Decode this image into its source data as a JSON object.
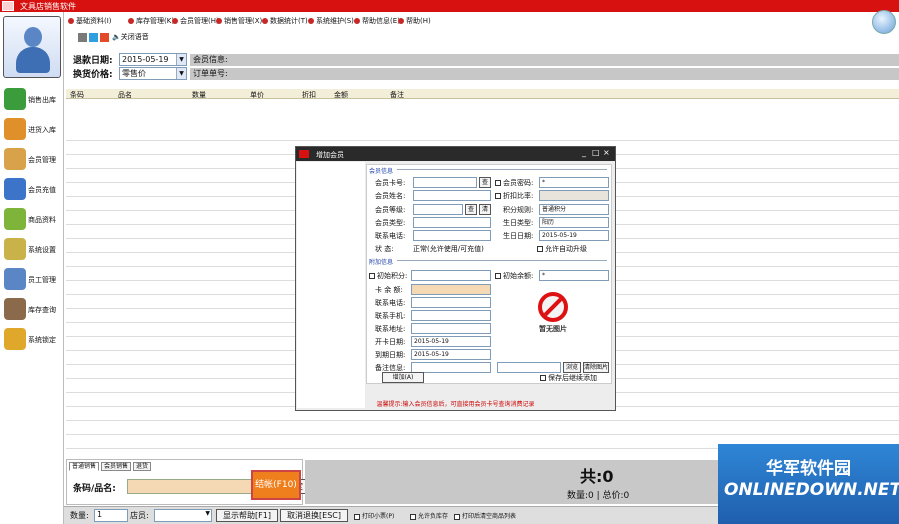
{
  "window": {
    "title": "文具店销售软件"
  },
  "menu": [
    "基础资料(I)",
    "库存管理(K)",
    "会员管理(H)",
    "销售管理(X)",
    "数据统计(T)",
    "系统维护(S)",
    "帮助信息(E)",
    "帮助(H)"
  ],
  "toolbar": {
    "volume_label": "关闭语音 ",
    "colors": [
      "#7a7a7a",
      "#2f9fe0",
      "#e24a2a"
    ]
  },
  "sidebar": {
    "items": [
      {
        "label": "销售出库",
        "icon": "cashier-icon",
        "color": "#3a9c3a"
      },
      {
        "label": "进货入库",
        "icon": "boxes-icon",
        "color": "#e0902a"
      },
      {
        "label": "会员管理",
        "icon": "members-icon",
        "color": "#d8a24a"
      },
      {
        "label": "会员充值",
        "icon": "card-icon",
        "color": "#3c74c9"
      },
      {
        "label": "商品资料",
        "icon": "goods-icon",
        "color": "#7fb43a"
      },
      {
        "label": "系统设置",
        "icon": "tools-icon",
        "color": "#c9b24a"
      },
      {
        "label": "员工管理",
        "icon": "staff-icon",
        "color": "#5a86c6"
      },
      {
        "label": "库存查询",
        "icon": "house-icon",
        "color": "#8a6a4a"
      },
      {
        "label": "系统锁定",
        "icon": "lock-icon",
        "color": "#e0a82a"
      }
    ]
  },
  "filters": {
    "date_label": "退款日期:",
    "date_value": "2015-05-19",
    "price_label": "换货价格:",
    "price_value": "零售价",
    "member_info": "会员信息:",
    "receipt_no": "订单单号:"
  },
  "table": {
    "headers": [
      "条码",
      "品名",
      "数量",
      "单价",
      "折扣",
      "金额",
      "备注"
    ]
  },
  "dialog": {
    "title": "增加会员",
    "section_basic": "会员信息",
    "section_more": "附加信息",
    "fields": {
      "card_no": "会员卡号:",
      "member_name": "会员姓名:",
      "member_level": "会员等级:",
      "member_type": "会员类型:",
      "phone": "联系电话:",
      "status": "状    态:",
      "status_value": "正常(允许使用/可充值)",
      "password": "会员密码:",
      "discount_rate": "折扣比率:",
      "points_rule": "积分规则:",
      "points_rule_value": "普通积分",
      "birthday_type": "生日类型:",
      "birthday_type_value": "阳历",
      "birthday": "生日日期:",
      "birthday_value": "2015-05-19",
      "auto_upgrade": "允许自动升级",
      "init_points": "初始积分:",
      "init_balance": "初始余额:",
      "balance": "卡 余 额:",
      "contact1": "联系电话:",
      "contact2": "联系手机:",
      "address": "联系地址:",
      "open_date": "开卡日期:",
      "open_date_value": "2015-05-19",
      "expire_date": "到期日期:",
      "expire_date_value": "2015-05-19",
      "note": "备注信息:",
      "password_value": "*",
      "confirm_value": "*"
    },
    "photo_text": "暂无图片",
    "browse_btn": "浏览",
    "clear_btn": "清除图片",
    "add_btn": "增加(A)",
    "keep_open": "保存后继续添加",
    "hint": "温馨提示:输入会员信息后，可直接用会员卡号查询消费记录",
    "search_btn": "查",
    "clear_small": "清"
  },
  "bottom": {
    "tabs": [
      "普通销售",
      "会员销售",
      "退货"
    ],
    "code_label": "条码/品名:",
    "confirm_btn": "确定",
    "checkout_btn": "结帐(F10)",
    "total_label": "共:0",
    "stats_label": "数量:0 | 总价:0"
  },
  "status": {
    "qty_label": "数量:",
    "qty_value": "1",
    "store_label": "店员:",
    "show_help": "显示帮助[F1]",
    "cancel_btn": "取消退换[ESC]",
    "checks": [
      "打印小票(P)",
      "允许负库存",
      "打印后清空商品列表"
    ]
  },
  "watermark": {
    "cn": "华军软件园",
    "en": "ONLINEDOWN.NET"
  }
}
